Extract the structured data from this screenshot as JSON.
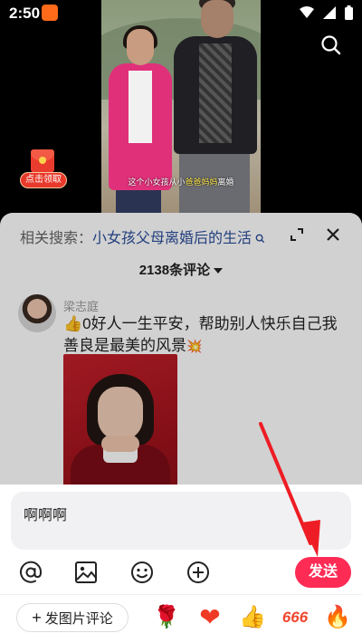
{
  "status_bar": {
    "time": "2:50"
  },
  "video": {
    "subtitle_prefix": "这个小女孩从小",
    "subtitle_highlight": "爸爸妈妈",
    "subtitle_suffix": "离婚",
    "red_packet_label": "点击领取"
  },
  "sheet": {
    "related_label": "相关搜索：",
    "related_query": "小女孩父母离婚后的生活",
    "comment_count": "2138条评论",
    "comment": {
      "username": "梁志庭",
      "text_emoji": "👍",
      "text": "0好人一生平安，帮助别人快乐自己我善良是最美的风景",
      "text_end_emoji": "💥"
    }
  },
  "composer": {
    "input_value": "啊啊啊",
    "send_label": "发送",
    "image_comment_label": "发图片评论",
    "quick_emojis": [
      "🌹",
      "❤",
      "👍",
      "666",
      "🔥"
    ]
  },
  "colors": {
    "accent": "#fe2c55",
    "link": "#2a4e9a",
    "arrow": "#ee1c24"
  }
}
